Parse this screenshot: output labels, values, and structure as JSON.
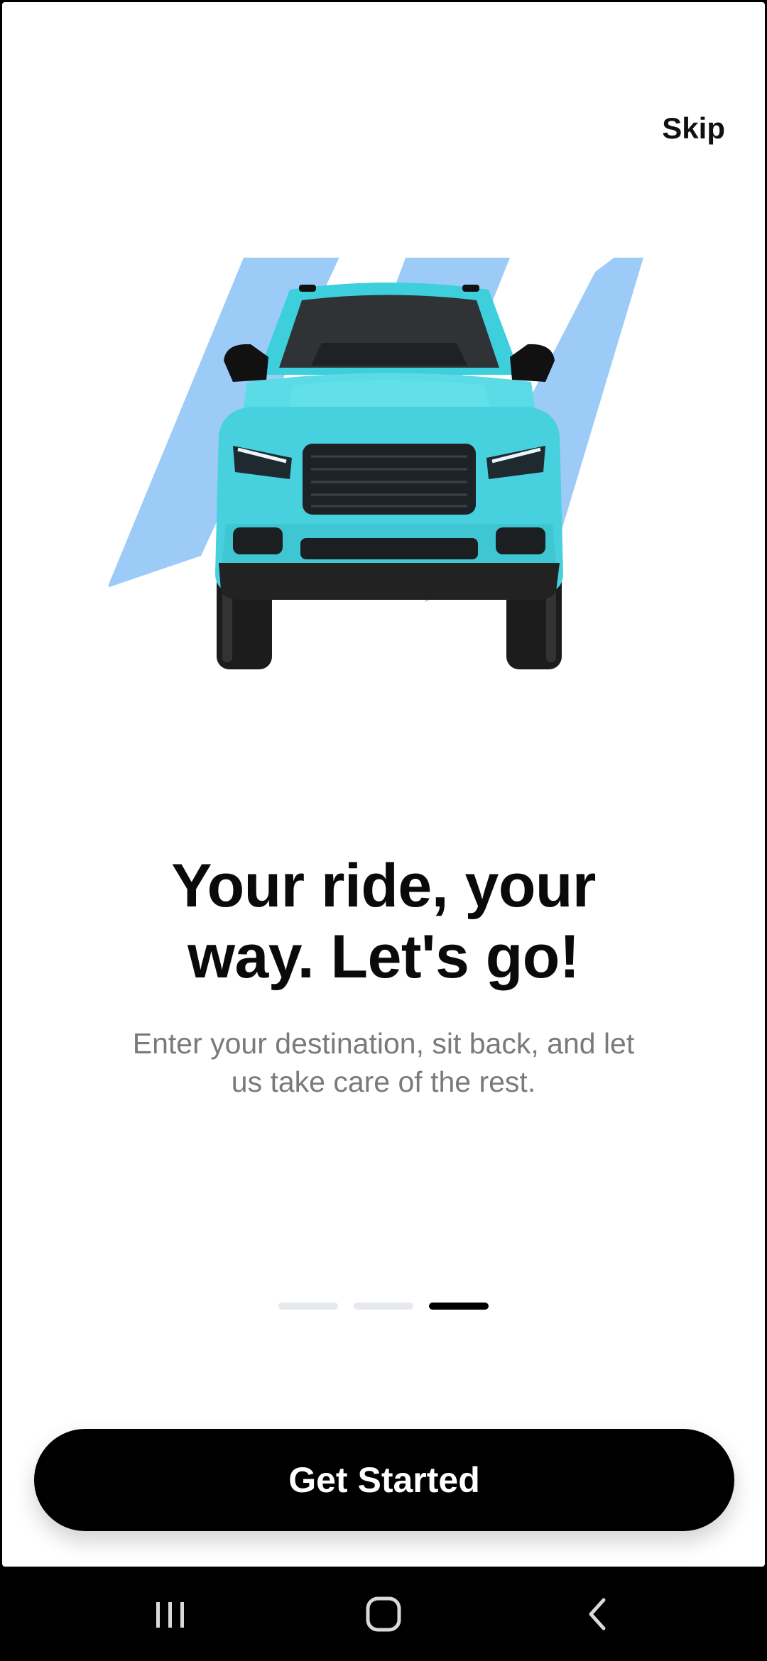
{
  "header": {
    "skip_label": "Skip"
  },
  "onboarding": {
    "title_line1": "Your ride, your",
    "title_line2": "way. Let's go!",
    "subtitle_line1": "Enter your destination, sit back, and let",
    "subtitle_line2": "us take care of the rest.",
    "page_indicator": {
      "total_pages": 3,
      "current_page": 3
    },
    "hero_icon": "car-illustration"
  },
  "cta": {
    "label": "Get Started"
  },
  "system_nav": {
    "items": [
      "recent-apps-icon",
      "home-icon",
      "back-icon"
    ]
  },
  "colors": {
    "accent_stripes": "#9ccbf8",
    "car_body": "#4fd4e0",
    "button_bg": "#000000",
    "button_text": "#ffffff",
    "subtitle": "#7a7a7a",
    "dot_inactive": "#e6e9ee",
    "dot_active": "#000000"
  }
}
